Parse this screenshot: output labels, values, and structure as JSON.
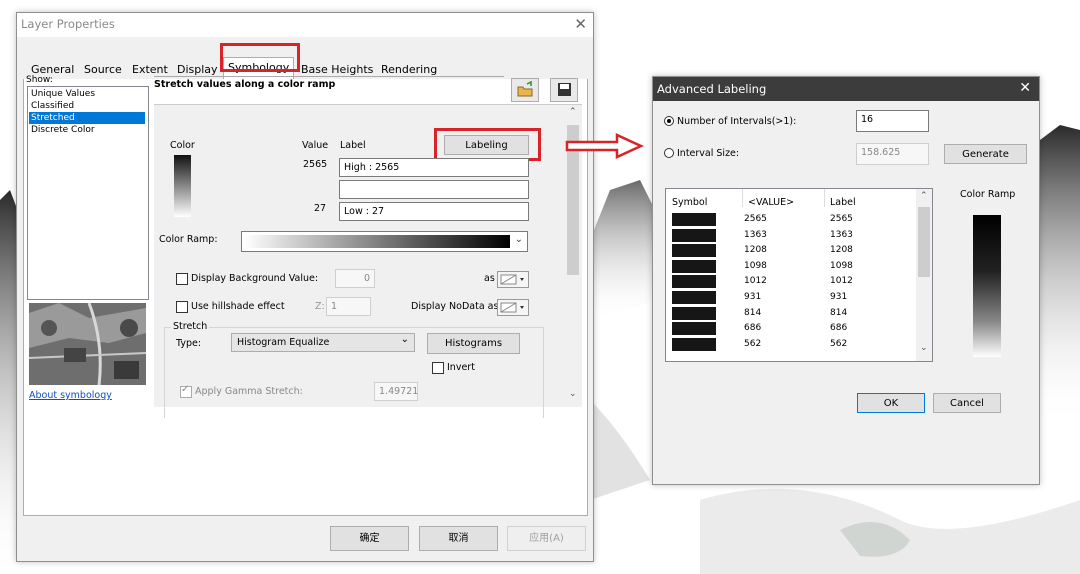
{
  "layer_properties": {
    "title": "Layer Properties",
    "close_glyph": "✕",
    "tabs": [
      "General",
      "Source",
      "Extent",
      "Display",
      "Symbology",
      "Base Heights",
      "Rendering"
    ],
    "active_tab": "Symbology",
    "show_label": "Show:",
    "show_items": [
      "Unique Values",
      "Classified",
      "Stretched",
      "Discrete Color"
    ],
    "show_selected": "Stretched",
    "heading": "Stretch values along a color ramp",
    "color_label": "Color",
    "value_header": "Value",
    "label_header": "Label",
    "labeling_button": "Labeling",
    "high_value": "2565",
    "high_label": "High : 2565",
    "low_value": "27",
    "low_label": "Low : 27",
    "mid_label": "",
    "color_ramp_label": "Color Ramp:",
    "display_background_label": "Display Background Value:",
    "background_value": "0",
    "as_label": "as",
    "hillshade_label": "Use hillshade effect",
    "z_label": "Z:",
    "z_value": "1",
    "nodata_label": "Display NoData as",
    "stretch_group": "Stretch",
    "type_label": "Type:",
    "type_value": "Histogram Equalize",
    "histograms_button": "Histograms",
    "invert_label": "Invert",
    "gamma_label": "Apply Gamma Stretch:",
    "gamma_value": "1.49721",
    "about_link": "About symbology",
    "ok_button": "确定",
    "cancel_button": "取消",
    "apply_button": "应用(A)"
  },
  "advanced_labeling": {
    "title": "Advanced Labeling",
    "close_glyph": "✕",
    "intervals_label": "Number of Intervals(>1):",
    "intervals_value": "16",
    "interval_size_label": "Interval Size:",
    "interval_size_value": "158.625",
    "generate_button": "Generate",
    "col_symbol": "Symbol",
    "col_value": "<VALUE>",
    "col_label": "Label",
    "rows": [
      {
        "value": "2565",
        "label": "2565"
      },
      {
        "value": "1363",
        "label": "1363"
      },
      {
        "value": "1208",
        "label": "1208"
      },
      {
        "value": "1098",
        "label": "1098"
      },
      {
        "value": "1012",
        "label": "1012"
      },
      {
        "value": "931",
        "label": "931"
      },
      {
        "value": "814",
        "label": "814"
      },
      {
        "value": "686",
        "label": "686"
      },
      {
        "value": "562",
        "label": "562"
      }
    ],
    "color_ramp_label": "Color Ramp",
    "ok_button": "OK",
    "cancel_button": "Cancel"
  },
  "colors": {
    "highlight_red": "#d8232a",
    "selection_blue": "#0078d7",
    "link_blue": "#0b4fc2"
  },
  "icons": [
    "open-folder-icon",
    "save-icon",
    "scroll-up-icon",
    "scroll-down-icon",
    "chevron-down-icon",
    "arrow-right-icon",
    "close-icon"
  ]
}
